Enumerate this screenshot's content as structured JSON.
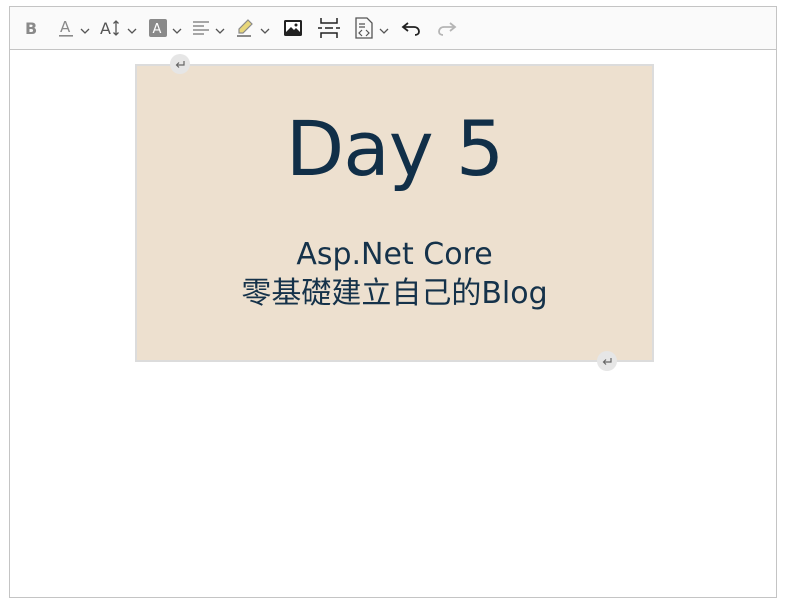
{
  "toolbar": {
    "bold": "bold-icon",
    "font_color": "font-color-icon",
    "font_size": "font-size-icon",
    "font_background": "font-background-color-icon",
    "alignment": "align-left-icon",
    "highlight": "highlight-icon",
    "insert_image": "image-icon",
    "page_break": "page-break-icon",
    "source_editing": "source-icon",
    "undo": "undo-icon",
    "redo": "redo-icon"
  },
  "image": {
    "title": "Day 5",
    "subtitle_line1": "Asp.Net Core",
    "subtitle_line2": "零基礎建立自己的Blog",
    "background_color": "#ede0cf",
    "text_color": "#112f48"
  },
  "colors": {
    "editor_border": "#c4c4c4",
    "toolbar_bg": "#fafafa",
    "icon": "#333333",
    "chevron": "#555555",
    "disabled": "#b5b5b5"
  }
}
